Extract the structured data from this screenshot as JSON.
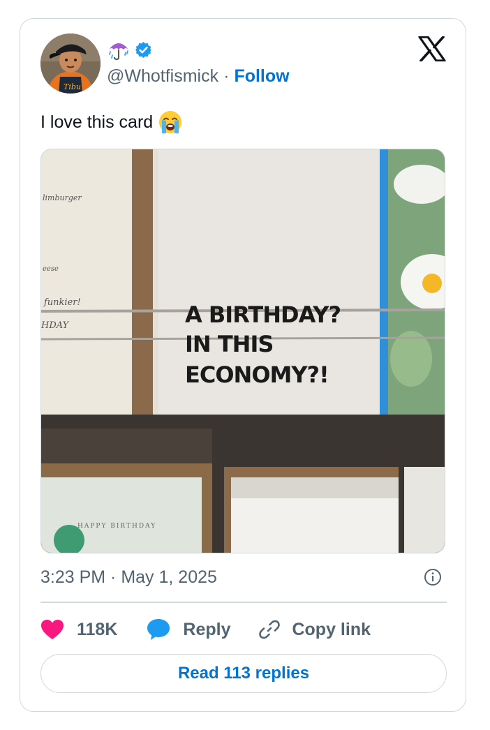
{
  "author": {
    "avatar_description": "avatar",
    "display_icon": "umbrella-with-rain-icon",
    "verified_icon": "verified-badge-icon",
    "handle": "@Whotfismick",
    "separator": "·",
    "follow_label": "Follow"
  },
  "brand": {
    "logo": "x-logo-icon"
  },
  "tweet": {
    "text": "I love this card",
    "emoji": "loudly-crying-face-icon"
  },
  "photo": {
    "card_main_lines": [
      "A BIRTHDAY?",
      "IN THIS",
      "ECONOMY?!"
    ],
    "left_card_lines": [
      "limburger",
      "eese",
      "funkier!",
      "HDAY"
    ],
    "bottom_card_text": "HAPPY BIRTHDAY"
  },
  "meta": {
    "timestamp": "3:23 PM · May 1, 2025",
    "info_icon": "info-icon"
  },
  "actions": {
    "like_count": "118K",
    "reply_label": "Reply",
    "copy_label": "Copy link"
  },
  "footer": {
    "read_replies_label": "Read 113 replies"
  },
  "colors": {
    "link_blue": "#0074d4",
    "heart_pink": "#f91880",
    "reply_blue": "#1d9bf0",
    "muted_text": "#536471",
    "border": "#cfd9de"
  }
}
